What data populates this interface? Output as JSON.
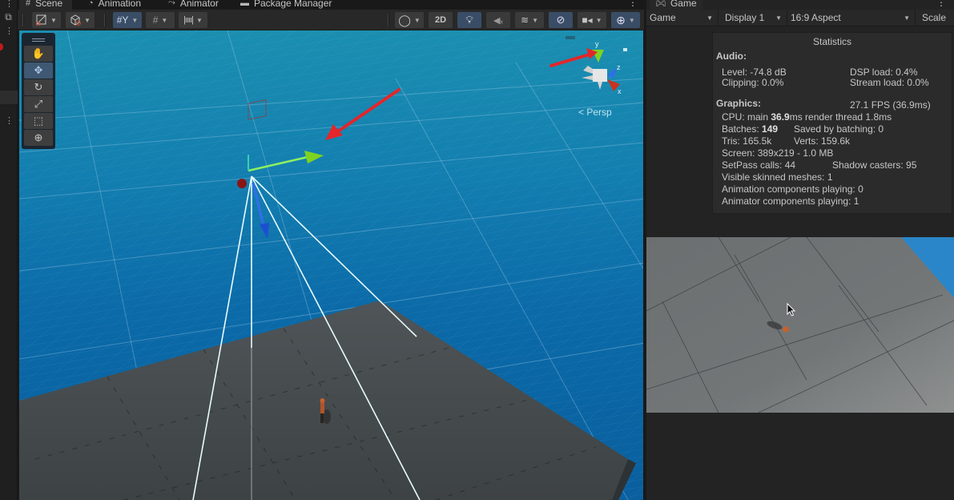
{
  "editor_tabs": [
    {
      "label": "Scene",
      "icon": "grid-hash-icon",
      "glyph": "#",
      "active": true
    },
    {
      "label": "Animation",
      "icon": "animation-clock-icon",
      "glyph": "◔"
    },
    {
      "label": "Animator",
      "icon": "animator-branch-icon",
      "glyph": "⤳"
    },
    {
      "label": "Package Manager",
      "icon": "package-icon",
      "glyph": "▬"
    }
  ],
  "scene_toolbar": {
    "draw_mode_icon": "shaded-draw-mode-icon",
    "render_mode_icon": "render-cube-icon",
    "grid_snap_icon": "grid-snap-icon",
    "increment_snap_icon": "increment-snap-icon",
    "ruler_icon": "ruler-icon",
    "shading_icon": "sphere-shading-icon",
    "toggle_2d_label": "2D",
    "lighting_icon": "lightbulb-icon",
    "audio_icon": "audio-mute-icon",
    "effects_icon": "effects-layers-icon",
    "hidden_objects_icon": "visibility-hidden-icon",
    "camera_icon": "camera-icon",
    "gizmos_icon": "gizmos-globe-icon"
  },
  "tool_palette": [
    {
      "name": "hand-tool",
      "glyph": "✋",
      "active": false
    },
    {
      "name": "move-tool",
      "glyph": "✥",
      "active": true
    },
    {
      "name": "rotate-tool",
      "glyph": "↻",
      "active": false
    },
    {
      "name": "scale-tool",
      "glyph": "⤢",
      "active": false
    },
    {
      "name": "rect-tool",
      "glyph": "⬚",
      "active": false
    },
    {
      "name": "transform-tool",
      "glyph": "⊕",
      "active": false
    }
  ],
  "scene_gizmo": {
    "axis_y": "y",
    "axis_z": "z",
    "axis_x": "x",
    "projection_label": "< Persp"
  },
  "game_panel": {
    "tab_label": "Game",
    "tab_icon": "gamepad-icon",
    "mode_select": "Game",
    "display_select": "Display 1",
    "aspect_select": "16:9 Aspect",
    "scale_label": "Scale"
  },
  "statistics": {
    "title": "Statistics",
    "audio_label": "Audio:",
    "level": "Level: -74.8 dB",
    "dsp_load": "DSP load: 0.4%",
    "clipping": "Clipping: 0.0%",
    "stream_load": "Stream load: 0.0%",
    "graphics_label": "Graphics:",
    "fps": "27.1 FPS (36.9ms)",
    "cpu_prefix": "CPU: main ",
    "cpu_main": "36.9",
    "cpu_suffix": "ms  render thread 1.8ms",
    "batches_prefix": "Batches: ",
    "batches": "149",
    "saved_by_batching": "Saved by batching: 0",
    "tris": "Tris: 165.5k",
    "verts": "Verts: 159.6k",
    "screen": "Screen: 389x219 - 1.0 MB",
    "setpass": "SetPass calls: 44",
    "shadow_casters": "Shadow casters: 95",
    "visible_skinned": "Visible skinned meshes: 1",
    "animation_components": "Animation components playing: 0",
    "animator_components": "Animator components playing: 1"
  },
  "colors": {
    "annotation_arrow": "#e3262a",
    "axis_x": "#c8321f",
    "axis_y": "#7ed321",
    "axis_z": "#2f6fe6",
    "toolbar_active": "#3a4d66"
  }
}
